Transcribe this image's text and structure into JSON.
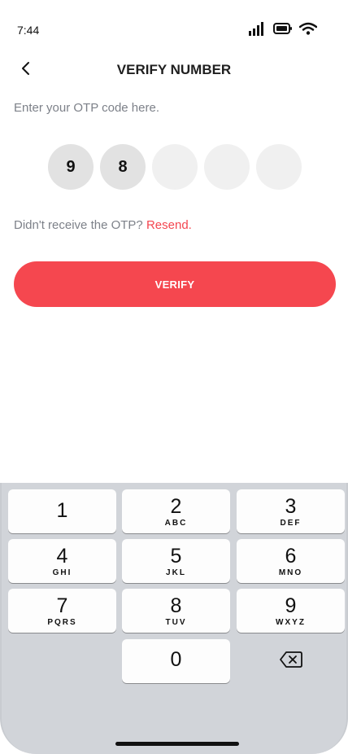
{
  "status_bar": {
    "time": "7:44",
    "icons": [
      "signal-icon",
      "battery-icon",
      "wifi-icon"
    ]
  },
  "header": {
    "back_icon": "chevron-left-icon",
    "title": "VERIFY NUMBER"
  },
  "instruction": "Enter your OTP code here.",
  "otp": {
    "digits": [
      "9",
      "8",
      "",
      "",
      ""
    ]
  },
  "resend": {
    "prompt": "Didn't receive the OTP?",
    "link": "Resend."
  },
  "verify_button": {
    "label": "VERIFY",
    "color": "#f5474f"
  },
  "keypad": {
    "keys": [
      {
        "digit": "1",
        "letters": ""
      },
      {
        "digit": "2",
        "letters": "ABC"
      },
      {
        "digit": "3",
        "letters": "DEF"
      },
      {
        "digit": "4",
        "letters": "GHI"
      },
      {
        "digit": "5",
        "letters": "JKL"
      },
      {
        "digit": "6",
        "letters": "MNO"
      },
      {
        "digit": "7",
        "letters": "PQRS"
      },
      {
        "digit": "8",
        "letters": "TUV"
      },
      {
        "digit": "9",
        "letters": "WXYZ"
      },
      {
        "digit": "0",
        "letters": ""
      }
    ],
    "delete_icon": "backspace-icon"
  },
  "colors": {
    "accent": "#f44650",
    "keyboard_bg": "#d1d4d9",
    "muted_text": "#7d8189"
  }
}
